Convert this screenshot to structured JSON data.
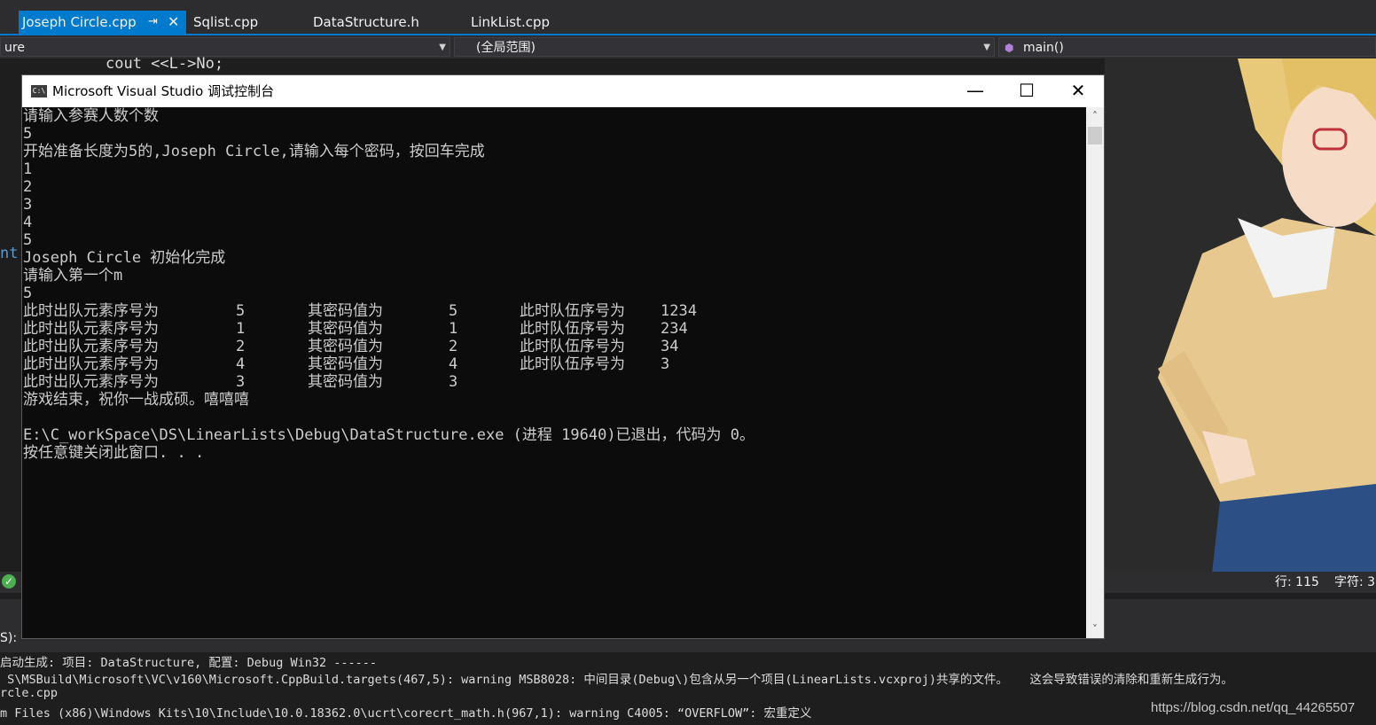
{
  "tabs": {
    "active": "Joseph Circle.cpp",
    "pin_icon": "pin-icon",
    "close_icon": "close-icon",
    "items": [
      "Sqlist.cpp",
      "DataStructure.h",
      "LinkList.cpp"
    ]
  },
  "navbar": {
    "left": "ure",
    "scope": "(全局范围)",
    "member": "main()"
  },
  "editor": {
    "code_line": "cout <<L->No;",
    "code_fragment": "nt"
  },
  "status": {
    "line": "行: 115",
    "char": "字符: 3"
  },
  "console": {
    "title": "Microsoft Visual Studio 调试控制台",
    "icon_label": "C:\\",
    "lines": [
      "请输入参赛人数个数",
      "5",
      "开始准备长度为5的,Joseph Circle,请输入每个密码，按回车完成",
      "1",
      "2",
      "3",
      "4",
      "5",
      "Joseph Circle 初始化完成",
      "请输入第一个m",
      "5"
    ],
    "dequeue_rows": [
      [
        "此时出队元素序号为",
        "5",
        "其密码值为",
        "5",
        "此时队伍序号为",
        "1234"
      ],
      [
        "此时出队元素序号为",
        "1",
        "其密码值为",
        "1",
        "此时队伍序号为",
        "234"
      ],
      [
        "此时出队元素序号为",
        "2",
        "其密码值为",
        "2",
        "此时队伍序号为",
        "34"
      ],
      [
        "此时出队元素序号为",
        "4",
        "其密码值为",
        "4",
        "此时队伍序号为",
        "3"
      ],
      [
        "此时出队元素序号为",
        "3",
        "其密码值为",
        "3",
        "",
        ""
      ]
    ],
    "end_lines": [
      "游戏结束，祝你一战成硕。嘻嘻嘻",
      "",
      "E:\\C_workSpace\\DS\\LinearLists\\Debug\\DataStructure.exe (进程 19640)已退出，代码为 0。",
      "按任意键关闭此窗口. . ."
    ]
  },
  "output": {
    "toolbar_label": "S):",
    "lines": [
      "启动生成: 项目: DataStructure, 配置: Debug Win32 ------",
      " S\\MSBuild\\Microsoft\\VC\\v160\\Microsoft.CppBuild.targets(467,5): warning MSB8028: 中间目录(Debug\\)包含从另一个项目(LinearLists.vcxproj)共享的文件。   这会导致错误的清除和重新生成行为。",
      "rcle.cpp",
      "m Files (x86)\\Windows Kits\\10\\Include\\10.0.18362.0\\ucrt\\corecrt_math.h(967,1): warning C4005: “OVERFLOW”: 宏重定义"
    ]
  },
  "watermark": "https://blog.csdn.net/qq_44265507"
}
